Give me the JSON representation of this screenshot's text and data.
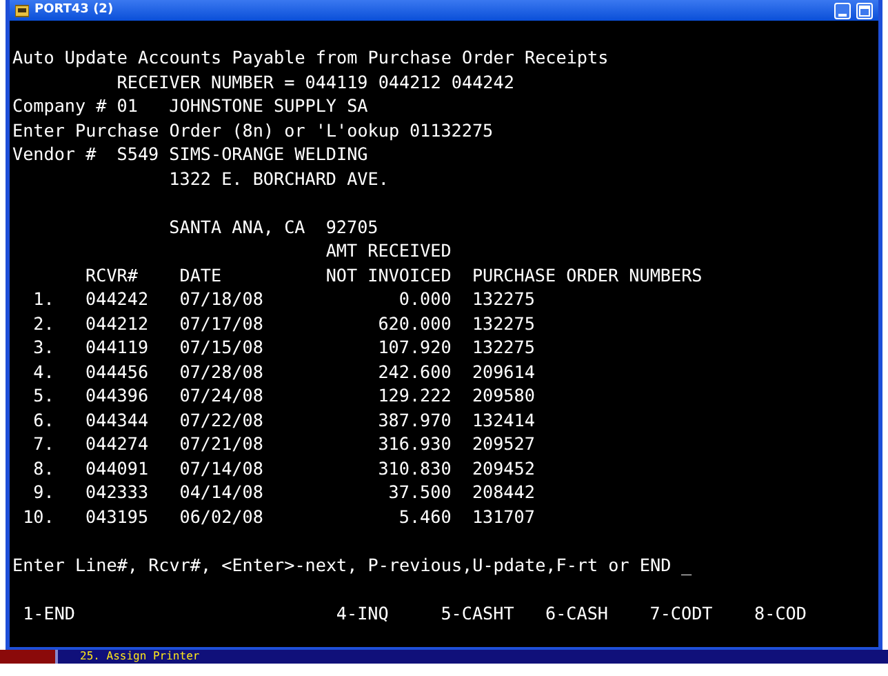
{
  "window": {
    "title": "PORT43 (2)"
  },
  "header": {
    "title": "Auto Update Accounts Payable from Purchase Order Receipts",
    "receiver_label": "RECEIVER NUMBER =",
    "receiver_numbers": [
      "044119",
      "044212",
      "044242"
    ],
    "company_label": "Company #",
    "company_number": "01",
    "company_name": "JOHNSTONE SUPPLY SA",
    "po_prompt": "Enter Purchase Order (8n) or 'L'ookup",
    "po_value": "01132275",
    "vendor_label": "Vendor #",
    "vendor_code": "S549",
    "vendor_name": "SIMS-ORANGE WELDING",
    "vendor_address": "1322 E. BORCHARD AVE.",
    "vendor_city": "SANTA ANA, CA",
    "vendor_zip": "92705"
  },
  "table": {
    "columns": [
      {
        "label": "RCVR#"
      },
      {
        "label": "DATE"
      },
      {
        "label": "AMT RECEIVED",
        "label_line_2": "NOT INVOICED"
      },
      {
        "label": "PURCHASE ORDER NUMBERS"
      }
    ],
    "rows": [
      {
        "line": "1.",
        "rcvr": "044242",
        "date": "07/18/08",
        "amount": "0.000",
        "po": "132275"
      },
      {
        "line": "2.",
        "rcvr": "044212",
        "date": "07/17/08",
        "amount": "620.000",
        "po": "132275"
      },
      {
        "line": "3.",
        "rcvr": "044119",
        "date": "07/15/08",
        "amount": "107.920",
        "po": "132275"
      },
      {
        "line": "4.",
        "rcvr": "044456",
        "date": "07/28/08",
        "amount": "242.600",
        "po": "209614"
      },
      {
        "line": "5.",
        "rcvr": "044396",
        "date": "07/24/08",
        "amount": "129.222",
        "po": "209580"
      },
      {
        "line": "6.",
        "rcvr": "044344",
        "date": "07/22/08",
        "amount": "387.970",
        "po": "132414"
      },
      {
        "line": "7.",
        "rcvr": "044274",
        "date": "07/21/08",
        "amount": "316.930",
        "po": "209527"
      },
      {
        "line": "8.",
        "rcvr": "044091",
        "date": "07/14/08",
        "amount": "310.830",
        "po": "209452"
      },
      {
        "line": "9.",
        "rcvr": "042333",
        "date": "04/14/08",
        "amount": "37.500",
        "po": "208442"
      },
      {
        "line": "10.",
        "rcvr": "043195",
        "date": "06/02/08",
        "amount": "5.460",
        "po": "131707"
      }
    ]
  },
  "prompt": {
    "text": "Enter Line#, Rcvr#, <Enter>-next, P-revious,U-pdate,F-rt or END",
    "cursor": "_"
  },
  "function_keys": [
    {
      "label": "1-END"
    },
    {
      "label": "4-INQ"
    },
    {
      "label": "5-CASHT"
    },
    {
      "label": "6-CASH"
    },
    {
      "label": "7-CODT"
    },
    {
      "label": "8-COD"
    }
  ],
  "background_window": {
    "menu_item": "25. Assign Printer"
  }
}
